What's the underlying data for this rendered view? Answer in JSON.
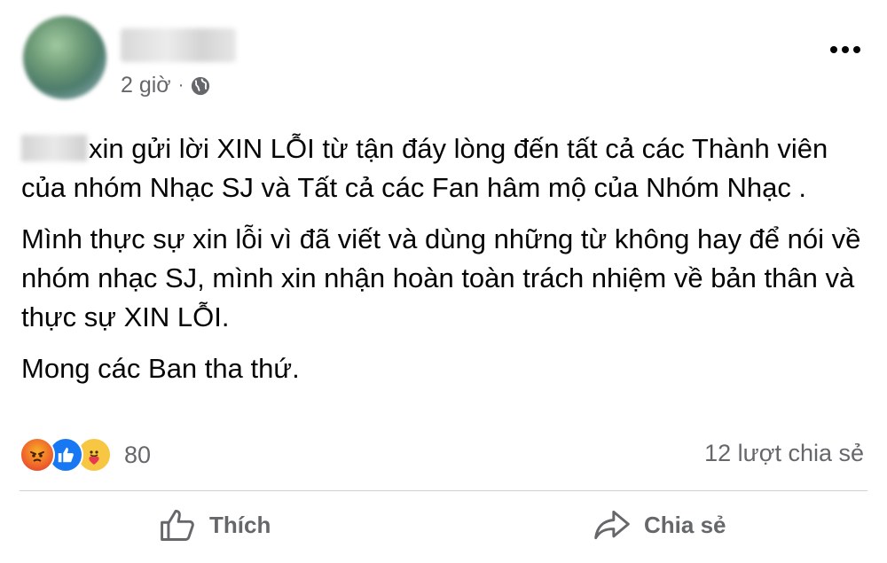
{
  "post": {
    "author_name": "",
    "timestamp": "2 giờ",
    "separator": "·",
    "audience_icon": "globe-icon",
    "more_icon": "more-options-icon"
  },
  "content": {
    "paragraph1_rest": "xin gửi lời XIN LỖI từ tận đáy lòng đến tất cả các Thành viên của nhóm Nhạc SJ và Tất cả các Fan hâm mộ của Nhóm Nhạc .",
    "paragraph2": "Mình thực sự xin lỗi vì đã viết và dùng những từ không hay để nói về nhóm nhạc SJ, mình xin nhận hoàn toàn trách nhiệm về bản thân và thực sự XIN LỖI.",
    "paragraph3": "Mong các Ban tha thứ."
  },
  "reactions": {
    "icons": [
      "angry-icon",
      "like-icon",
      "care-icon"
    ],
    "count": "80",
    "shares": "12 lượt chia sẻ"
  },
  "actions": {
    "like_label": "Thích",
    "share_label": "Chia sẻ"
  },
  "colors": {
    "secondary_text": "#65676b",
    "like_blue": "#1877f2",
    "divider": "#ced0d4"
  }
}
